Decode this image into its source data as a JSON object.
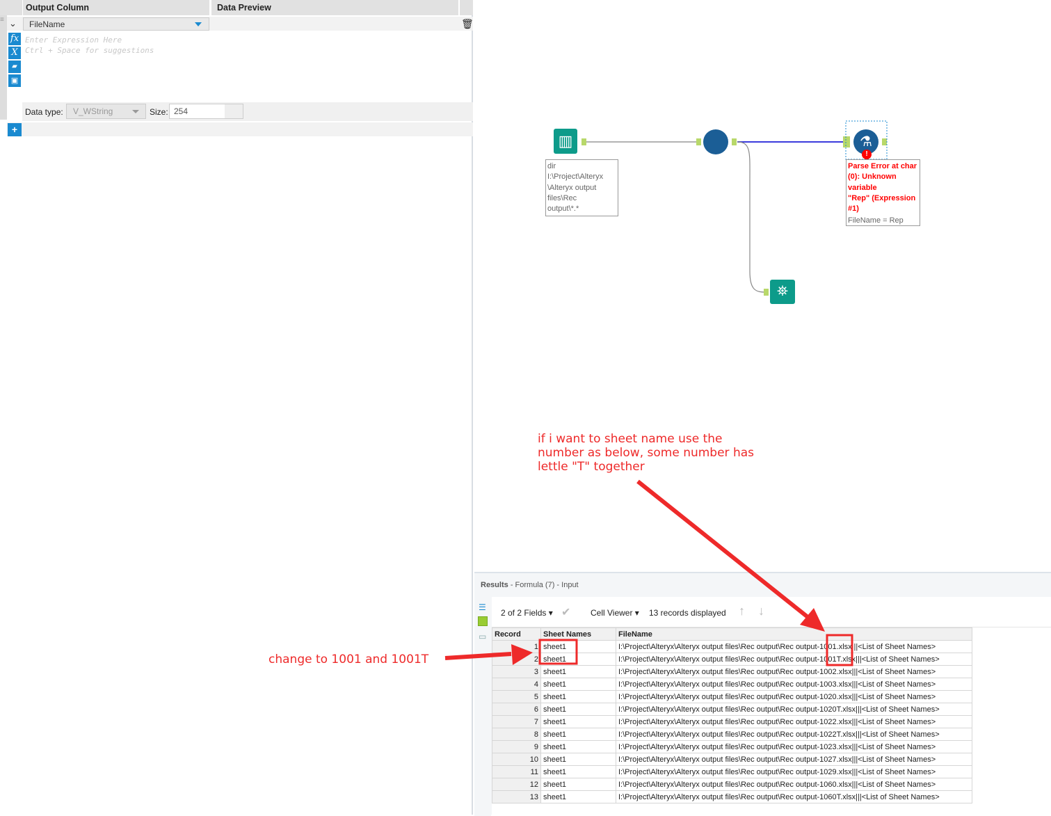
{
  "formula": {
    "col_output": "Output Column",
    "col_preview": "Data Preview",
    "field": "FileName",
    "placeholder1": "Enter Expression Here",
    "placeholder2": "Ctrl + Space for suggestions",
    "datatype_label": "Data type:",
    "datatype": "V_WString",
    "size_label": "Size:",
    "size": "254"
  },
  "workflow": {
    "input_annotation": [
      "dir",
      "I:\\Project\\Alteryx",
      "\\Alteryx output",
      "files\\Rec",
      "output\\*.*"
    ],
    "error_lines": [
      "Parse Error at char",
      "(0): Unknown",
      "variable",
      "\"Rep\" (Expression",
      "#1)"
    ],
    "formula_text": "FileName = Rep"
  },
  "results": {
    "title": "Results",
    "subtitle": "- Formula (7) - Input",
    "fields": "2 of 2 Fields",
    "viewer": "Cell Viewer",
    "records": "13 records displayed",
    "columns": [
      "Record",
      "Sheet Names",
      "FileName"
    ],
    "rows": [
      [
        "1",
        "sheet1",
        "I:\\Project\\Alteryx\\Alteryx output files\\Rec output\\Rec output-1001.xlsx|||<List of Sheet Names>"
      ],
      [
        "2",
        "sheet1",
        "I:\\Project\\Alteryx\\Alteryx output files\\Rec output\\Rec output-1001T.xlsx|||<List of Sheet Names>"
      ],
      [
        "3",
        "sheet1",
        "I:\\Project\\Alteryx\\Alteryx output files\\Rec output\\Rec output-1002.xlsx|||<List of Sheet Names>"
      ],
      [
        "4",
        "sheet1",
        "I:\\Project\\Alteryx\\Alteryx output files\\Rec output\\Rec output-1003.xlsx|||<List of Sheet Names>"
      ],
      [
        "5",
        "sheet1",
        "I:\\Project\\Alteryx\\Alteryx output files\\Rec output\\Rec output-1020.xlsx|||<List of Sheet Names>"
      ],
      [
        "6",
        "sheet1",
        "I:\\Project\\Alteryx\\Alteryx output files\\Rec output\\Rec output-1020T.xlsx|||<List of Sheet Names>"
      ],
      [
        "7",
        "sheet1",
        "I:\\Project\\Alteryx\\Alteryx output files\\Rec output\\Rec output-1022.xlsx|||<List of Sheet Names>"
      ],
      [
        "8",
        "sheet1",
        "I:\\Project\\Alteryx\\Alteryx output files\\Rec output\\Rec output-1022T.xlsx|||<List of Sheet Names>"
      ],
      [
        "9",
        "sheet1",
        "I:\\Project\\Alteryx\\Alteryx output files\\Rec output\\Rec output-1023.xlsx|||<List of Sheet Names>"
      ],
      [
        "10",
        "sheet1",
        "I:\\Project\\Alteryx\\Alteryx output files\\Rec output\\Rec output-1027.xlsx|||<List of Sheet Names>"
      ],
      [
        "11",
        "sheet1",
        "I:\\Project\\Alteryx\\Alteryx output files\\Rec output\\Rec output-1029.xlsx|||<List of Sheet Names>"
      ],
      [
        "12",
        "sheet1",
        "I:\\Project\\Alteryx\\Alteryx output files\\Rec output\\Rec output-1060.xlsx|||<List of Sheet Names>"
      ],
      [
        "13",
        "sheet1",
        "I:\\Project\\Alteryx\\Alteryx output files\\Rec output\\Rec output-1060T.xlsx|||<List of Sheet Names>"
      ]
    ]
  },
  "annotations": {
    "top": [
      "if i want to sheet name use the",
      "number as below, some number has",
      "lettle \"T\" together"
    ],
    "left": "change to 1001 and 1001T"
  },
  "colors": {
    "accent": "#1a8ad0",
    "error": "#ff0000",
    "annotation": "#ee2a2a",
    "tool_green": "#0d9b8a",
    "node_blue": "#1b5e96"
  }
}
